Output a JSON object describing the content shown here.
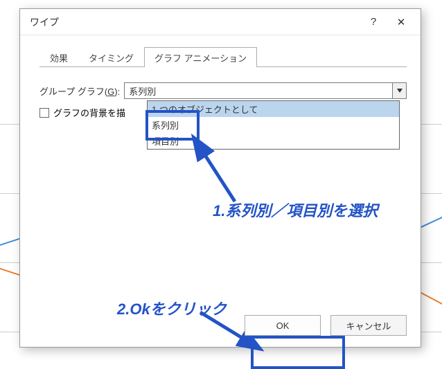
{
  "dialog": {
    "title": "ワイプ",
    "help_label": "?",
    "close_label": "✕"
  },
  "tabs": {
    "t1": "効果",
    "t2": "タイミング",
    "t3": "グラフ アニメーション"
  },
  "form": {
    "group_label_pre": "グループ グラフ(",
    "group_label_key": "G",
    "group_label_post": "):",
    "selected_value": "系列別",
    "checkbox_label": "グラフの背景を描"
  },
  "dropdown": {
    "opt1": "1 つのオブジェクトとして",
    "opt2": "系列別",
    "opt3": "項目別"
  },
  "annotations": {
    "a1": "1.系列別／項目別を選択",
    "a2": "2.Okをクリック"
  },
  "buttons": {
    "ok": "OK",
    "cancel": "キャンセル"
  }
}
